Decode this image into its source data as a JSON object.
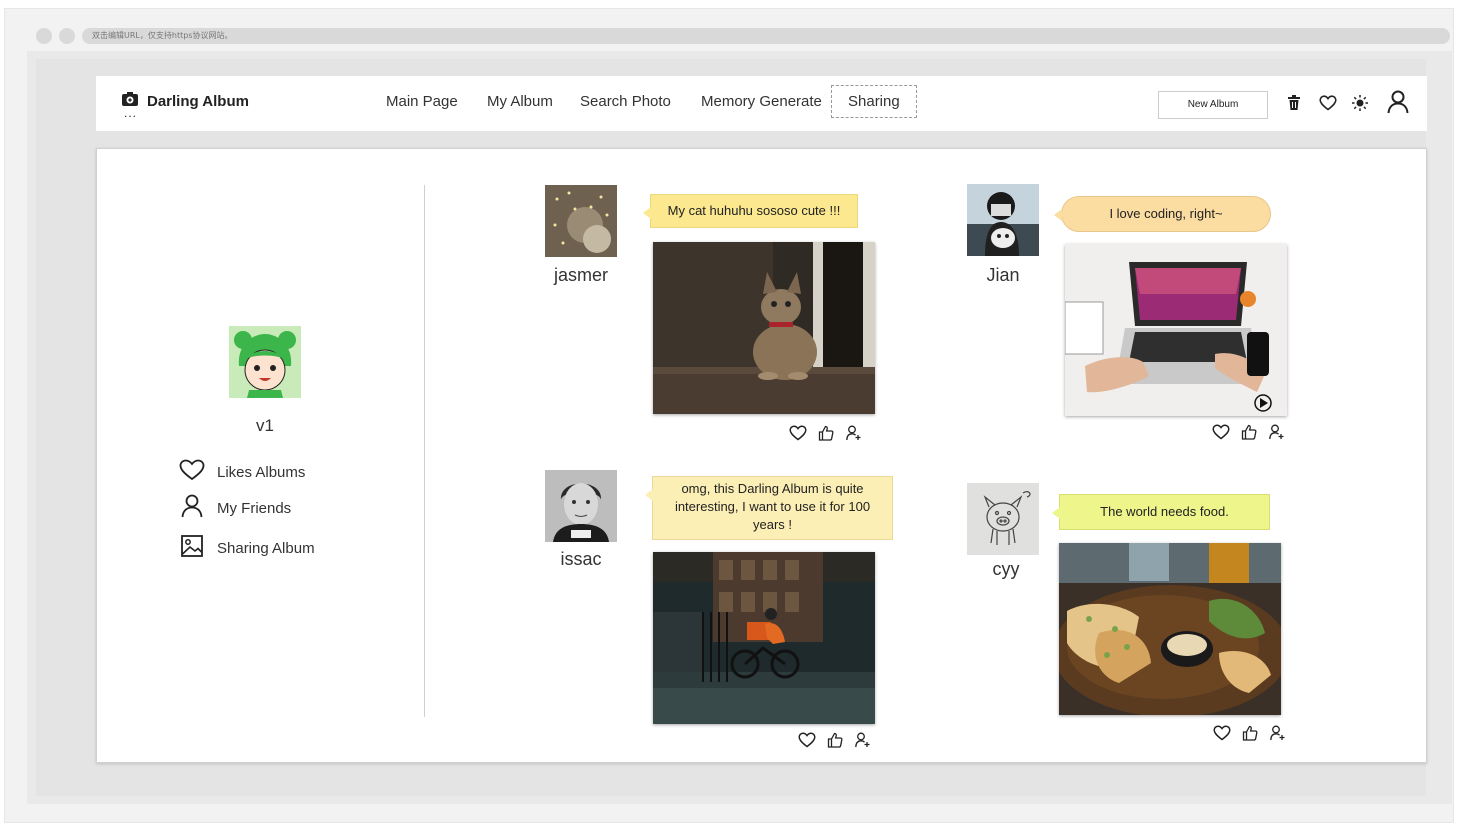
{
  "browser": {
    "url_hint": "双击编辑URL，仅支持https协议网站。"
  },
  "navbar": {
    "brand": "Darling Album",
    "brand_dots": "...",
    "items": [
      {
        "label": "Main Page"
      },
      {
        "label": "My Album"
      },
      {
        "label": "Search Photo"
      },
      {
        "label": "Memory Generate"
      },
      {
        "label": "Sharing",
        "active": true
      }
    ],
    "new_album_label": "New Album",
    "icons": [
      "trash-icon",
      "heart-icon",
      "sun-icon",
      "user-icon"
    ]
  },
  "sidebar": {
    "username": "v1",
    "links": [
      {
        "label": "Likes Albums",
        "icon": "heart-icon"
      },
      {
        "label": "My Friends",
        "icon": "user-icon"
      },
      {
        "label": "Sharing Album",
        "icon": "image-icon"
      }
    ]
  },
  "posts": [
    {
      "user": "jasmer",
      "comment": "My cat huhuhu sososo cute !!!",
      "photo": "cat photo",
      "bubble_color": "#fbe88f"
    },
    {
      "user": "Jian",
      "comment": "I love coding, right~",
      "photo": "laptop coding video",
      "bubble_color": "#fbdca1"
    },
    {
      "user": "issac",
      "comment": "omg, this Darling Album is quite interesting, I want to use it for 100 years !",
      "photo": "cyclist street photo",
      "bubble_color": "#fcefb6"
    },
    {
      "user": "cyy",
      "comment": "The world needs food.",
      "photo": "food plate photo",
      "bubble_color": "#eef58a"
    }
  ]
}
